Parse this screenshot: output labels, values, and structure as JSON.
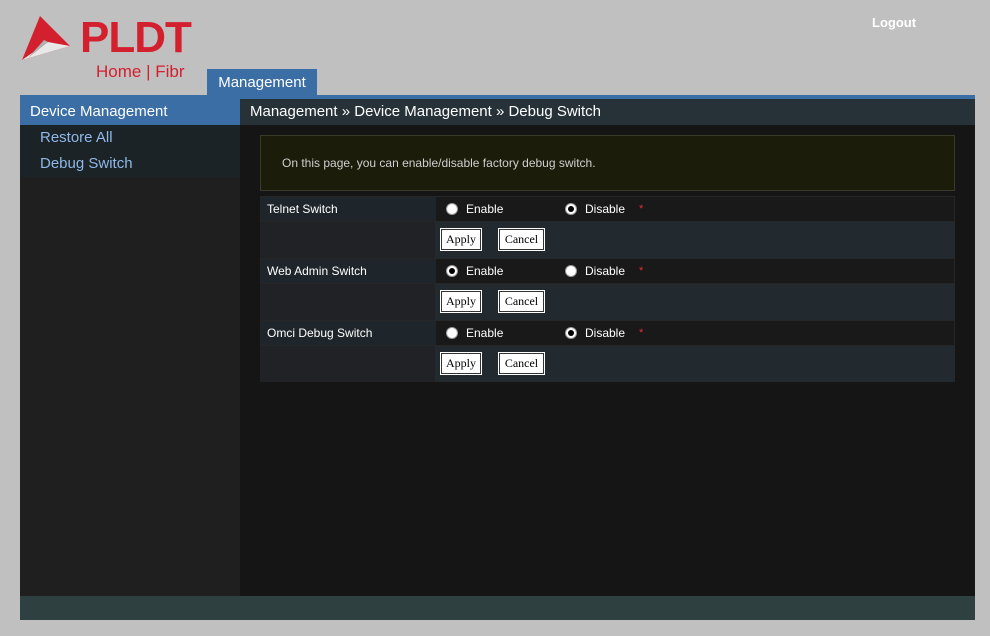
{
  "brand": {
    "name": "PLDT",
    "tagline": "Home | Fibr",
    "color": "#d3202f"
  },
  "header": {
    "logout_label": "Logout",
    "tab_label": "Management"
  },
  "sidebar": {
    "heading": "Device Management",
    "items": [
      {
        "label": "Restore All"
      },
      {
        "label": "Debug Switch"
      }
    ]
  },
  "breadcrumb": "Management » Device Management » Debug Switch",
  "info_text": "On this page, you can enable/disable factory debug switch.",
  "switches": [
    {
      "label": "Telnet Switch",
      "enable_label": "Enable",
      "disable_label": "Disable",
      "selected": "disable",
      "required": "*",
      "apply_label": "Apply",
      "cancel_label": "Cancel"
    },
    {
      "label": "Web Admin Switch",
      "enable_label": "Enable",
      "disable_label": "Disable",
      "selected": "enable",
      "required": "*",
      "apply_label": "Apply",
      "cancel_label": "Cancel"
    },
    {
      "label": "Omci Debug Switch",
      "enable_label": "Enable",
      "disable_label": "Disable",
      "selected": "disable",
      "required": "*",
      "apply_label": "Apply",
      "cancel_label": "Cancel"
    }
  ],
  "colors": {
    "accent": "#3b6ea5",
    "link": "#8fb8e8",
    "required": "#e03030"
  }
}
